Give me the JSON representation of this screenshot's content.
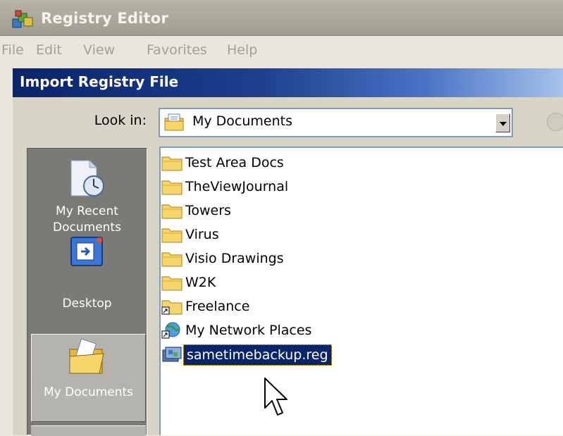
{
  "window": {
    "title": "Registry Editor"
  },
  "menu": [
    "File",
    "Edit",
    "View",
    "Favorites",
    "Help"
  ],
  "dialog": {
    "title": "Import Registry File",
    "look_in_label": "Look in:",
    "look_in_value": "My Documents"
  },
  "places": [
    {
      "label": "My Recent\nDocuments",
      "icon": "recent-documents-icon"
    },
    {
      "label": "Desktop",
      "icon": "desktop-icon"
    },
    {
      "label": "My Documents",
      "icon": "my-documents-icon",
      "selected": true
    }
  ],
  "files": [
    {
      "name": "Test Area Docs",
      "icon": "folder-icon"
    },
    {
      "name": "TheViewJournal",
      "icon": "folder-icon"
    },
    {
      "name": "Towers",
      "icon": "folder-icon"
    },
    {
      "name": "Virus",
      "icon": "folder-icon"
    },
    {
      "name": "Visio Drawings",
      "icon": "folder-icon"
    },
    {
      "name": "W2K",
      "icon": "folder-icon"
    },
    {
      "name": "Freelance",
      "icon": "folder-shortcut-icon"
    },
    {
      "name": "My Network Places",
      "icon": "network-places-icon"
    },
    {
      "name": "sametimebackup.reg",
      "icon": "registry-file-icon",
      "selected": true
    }
  ],
  "colors": {
    "dialog_title": "#0a246a",
    "selection": "#0a246a"
  }
}
